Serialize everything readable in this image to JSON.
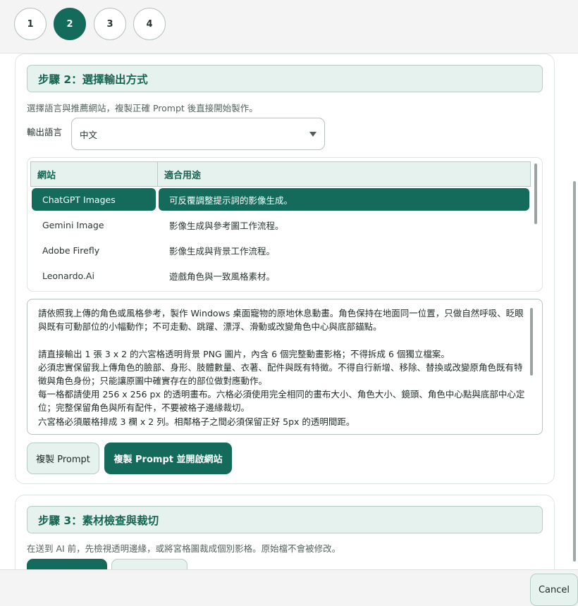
{
  "stepper": {
    "steps": [
      "1",
      "2",
      "3",
      "4"
    ],
    "active_index": 1
  },
  "step2": {
    "title": "步驟 2：選擇輸出方式",
    "description": "選擇語言與推薦網站，複製正確 Prompt 後直接開始製作。",
    "language_label": "輸出語言",
    "language_value": "中文",
    "table": {
      "headers": [
        "網站",
        "適合用途"
      ],
      "rows": [
        {
          "site": "ChatGPT Images",
          "use": "可反覆調整提示詞的影像生成。",
          "selected": true
        },
        {
          "site": "Gemini Image",
          "use": "影像生成與參考圖工作流程。",
          "selected": false
        },
        {
          "site": "Adobe Firefly",
          "use": "影像生成與背景工作流程。",
          "selected": false
        },
        {
          "site": "Leonardo.Ai",
          "use": "遊戲角色與一致風格素材。",
          "selected": false
        }
      ]
    },
    "prompt_text": "請依照我上傳的角色或風格參考，製作 Windows 桌面寵物的原地休息動畫。角色保持在地面同一位置，只做自然呼吸、眨眼與既有可動部位的小幅動作；不可走動、跳躍、漂浮、滑動或改變角色中心與底部錨點。\n\n請直接輸出 1 張 3 x 2 的六宮格透明背景 PNG 圖片，內含 6 個完整動畫影格；不得拆成 6 個獨立檔案。\n必須忠實保留我上傳角色的臉部、身形、肢體數量、衣著、配件與既有特徵。不得自行新增、移除、替換或改變原角色既有特徵與角色身份；只能讓原圖中確實存在的部位做對應動作。\n每一格都請使用 256 x 256 px 的透明畫布。六格必須使用完全相同的畫布大小、角色大小、鏡頭、角色中心點與底部中心定位；完整保留角色與所有配件，不要被格子邊緣裁切。\n六宮格必須嚴格排成 3 欄 x 2 列。相鄰格子之間必須保留正好 5px 的透明間距。",
    "copy_button": "複製 Prompt",
    "copy_open_button": "複製 Prompt 並開啟網站"
  },
  "step3": {
    "title": "步驟 3：素材檢查與裁切",
    "description": "在送到 AI 前，先檢視透明邊緣，或將宮格圖裁成個別影格。原始檔不會被修改。"
  },
  "footer": {
    "cancel_label": "Cancel"
  },
  "colors": {
    "accent": "#146b5c",
    "accent_light": "#e6f2ee",
    "heading_text": "#176452"
  }
}
